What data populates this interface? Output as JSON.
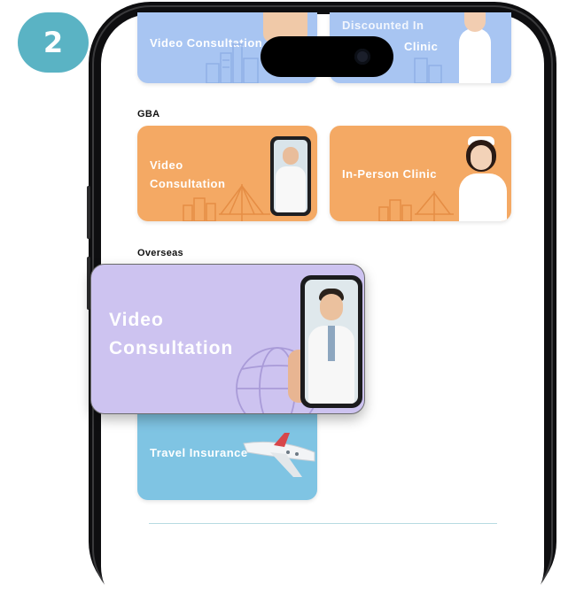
{
  "step": {
    "number": "2"
  },
  "top_row": {
    "left_card": {
      "title": "Video Consultation"
    },
    "right_card": {
      "title_partial": "Discounted In",
      "title_line2": "Clinic"
    }
  },
  "sections": {
    "gba": {
      "label": "GBA",
      "cards": [
        {
          "line1": "Video",
          "line2": "Consultation"
        },
        {
          "title": "In-Person Clinic"
        }
      ]
    },
    "overseas": {
      "label": "Overseas",
      "video_card": {
        "line1": "Video",
        "line2": "Consultation"
      },
      "travel_card": {
        "title": "Travel Insurance"
      }
    }
  },
  "colors": {
    "badge": "#5ab3c4",
    "card_blue": "#a8c5f2",
    "card_orange": "#f4a964",
    "card_lavender": "#cdc3f0",
    "card_sky": "#7fc4e3"
  }
}
